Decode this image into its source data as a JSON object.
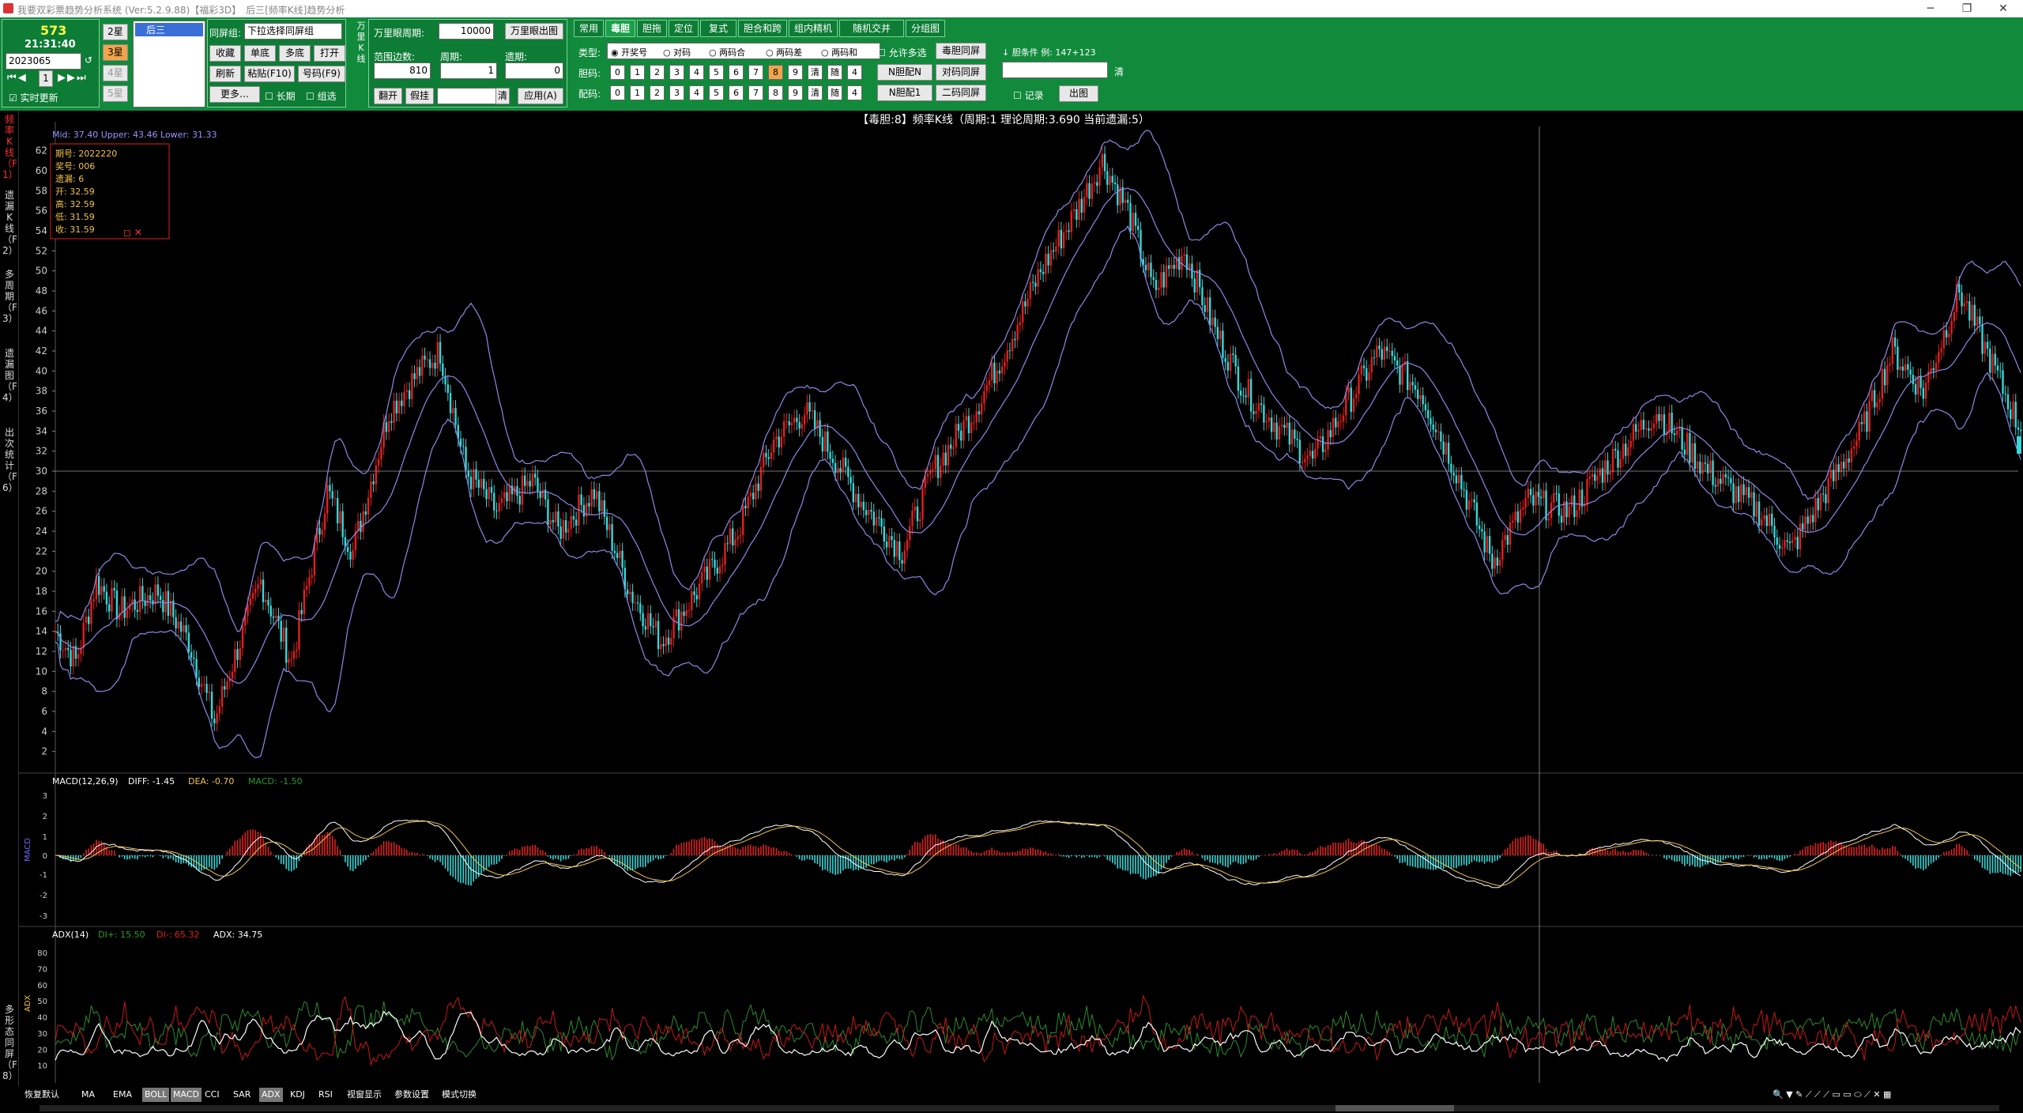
{
  "window": {
    "title": "我要双彩票趋势分析系统 (Ver:5.2.9.88)【福彩3D】　后三[频率K线]趋势分析",
    "min": "─",
    "max": "❐",
    "close": "✕"
  },
  "left": {
    "count": "573",
    "time": "21:31:40",
    "issue": "2023065",
    "play_text": "1",
    "auto_label": "实时更新",
    "stars": [
      "2星",
      "3星",
      "4星",
      "5星"
    ],
    "list_item": "后三"
  },
  "group": {
    "label": "同屏组:",
    "select": "下拉选择同屏组",
    "buttons": [
      "收藏",
      "单底",
      "多底",
      "打开",
      "刷新",
      "粘贴(F10)",
      "号码(F9)",
      "更多…"
    ],
    "chk_longest": "长期",
    "chk_group": "组选"
  },
  "wan": {
    "label": "万里眼周期:",
    "value": "10000",
    "btn": "万里眼出图",
    "fanwei_label": "范围边数:",
    "fanwei": "810",
    "zhouqi_label": "周期:",
    "zhouqi": "1",
    "yilou_label": "遗期:",
    "yilou": "0",
    "btn_fanchu": "翻开",
    "btn_jiagua": "假挂",
    "btn_clear": "清",
    "btn_apply": "应用(A)",
    "side_label": "万里K线"
  },
  "tabs": [
    "常用",
    "毒胆",
    "胆拖",
    "定位",
    "复式",
    "胆合和跨",
    "组内精机",
    "随机交并",
    "分组图"
  ],
  "filter": {
    "type_label": "类型:",
    "types": [
      "开奖号",
      "对码",
      "两码合",
      "两码差",
      "两码和"
    ],
    "multi": "允许多选",
    "btn_same": "毒胆同屏",
    "dan_label": "胆码:",
    "pei_label": "配码:",
    "digits": [
      "0",
      "1",
      "2",
      "3",
      "4",
      "5",
      "6",
      "7",
      "8",
      "9"
    ],
    "clr": "清",
    "rnd": "随",
    "n": "4",
    "btn_n1": "N胆配N",
    "btn_n2": "对码同屏",
    "btn_n3": "N胆配1",
    "btn_n4": "二码同屏"
  },
  "cond": {
    "label": "↓ 胆条件 例: 147+123",
    "clear": "清",
    "chk_label": "记录",
    "btn": "出图"
  },
  "sidebar": [
    "频率K线（F1）",
    "遗漏K线（F2）",
    "多周期（F3）",
    "遗漏图（F4）",
    "出次统计（F6）",
    "多形态同屏（F8）"
  ],
  "chart_info": {
    "title": "【毒胆:8】频率K线（周期:1 理论周期:3.690 当前遗漏:5）",
    "boll_label": "Mid: 37.40  Upper: 43.46  Lower: 31.33",
    "tooltip": [
      "期号: 2022220",
      "奖号: 006",
      "遗漏: 6",
      "开: 32.59",
      "高: 32.59",
      "低: 31.59",
      "收: 31.59"
    ],
    "macd_label": "MACD(12,26,9)",
    "macd_diff": "DIFF: -1.45",
    "macd_dea": "DEA: -0.70",
    "macd_val": "MACD: -1.50",
    "adx_label": "ADX(14)",
    "adx_di_p": "DI+: 15.50",
    "adx_di_m": "DI-: 65.32",
    "adx_val": "ADX: 34.75",
    "macd_side": "MACD",
    "adx_side": "ADX"
  },
  "chart_data": {
    "type": "candlestick",
    "series": [
      {
        "name": "频率K线"
      },
      {
        "name": "Mid"
      },
      {
        "name": "Upper"
      },
      {
        "name": "Lower"
      }
    ],
    "y_ticks": [
      "62",
      "60",
      "58",
      "56",
      "54",
      "52",
      "50",
      "48",
      "46",
      "44",
      "42",
      "40",
      "38",
      "36",
      "34",
      "32",
      "30",
      "28",
      "26",
      "24",
      "22",
      "20",
      "18",
      "16",
      "14",
      "12",
      "10",
      "8",
      "6",
      "4",
      "2"
    ],
    "ylim": [
      0,
      63
    ],
    "macd_ticks": [
      "3",
      "2",
      "1",
      "0",
      "-1",
      "-2",
      "-3"
    ],
    "adx_ticks": [
      "80",
      "70",
      "60",
      "50",
      "40",
      "30",
      "20",
      "10"
    ],
    "crosshair_y": 30,
    "anchors": [
      [
        0,
        14
      ],
      [
        8,
        11
      ],
      [
        16,
        19
      ],
      [
        25,
        16
      ],
      [
        40,
        18
      ],
      [
        52,
        13
      ],
      [
        62,
        5
      ],
      [
        68,
        10
      ],
      [
        80,
        19
      ],
      [
        92,
        11
      ],
      [
        106,
        28
      ],
      [
        116,
        22
      ],
      [
        130,
        36
      ],
      [
        142,
        40
      ],
      [
        150,
        42
      ],
      [
        160,
        30
      ],
      [
        172,
        26
      ],
      [
        186,
        29
      ],
      [
        196,
        24
      ],
      [
        210,
        28
      ],
      [
        224,
        18
      ],
      [
        236,
        13
      ],
      [
        250,
        18
      ],
      [
        266,
        24
      ],
      [
        280,
        33
      ],
      [
        292,
        36
      ],
      [
        302,
        32
      ],
      [
        314,
        27
      ],
      [
        330,
        22
      ],
      [
        342,
        30
      ],
      [
        358,
        36
      ],
      [
        370,
        42
      ],
      [
        384,
        50
      ],
      [
        398,
        56
      ],
      [
        408,
        61
      ],
      [
        418,
        56
      ],
      [
        428,
        48
      ],
      [
        440,
        52
      ],
      [
        452,
        44
      ],
      [
        464,
        38
      ],
      [
        478,
        34
      ],
      [
        490,
        31
      ],
      [
        504,
        37
      ],
      [
        516,
        42
      ],
      [
        532,
        38
      ],
      [
        546,
        30
      ],
      [
        560,
        21
      ],
      [
        574,
        27
      ],
      [
        590,
        26
      ],
      [
        606,
        31
      ],
      [
        624,
        36
      ],
      [
        644,
        30
      ],
      [
        664,
        26
      ],
      [
        676,
        22
      ],
      [
        690,
        28
      ],
      [
        704,
        34
      ],
      [
        716,
        42
      ],
      [
        728,
        38
      ],
      [
        742,
        48
      ],
      [
        756,
        40
      ],
      [
        766,
        34
      ]
    ],
    "n": 766
  },
  "bottom": {
    "items": [
      "恢复默认",
      "MA",
      "EMA",
      "BOLL",
      "MACD",
      "CCI",
      "SAR",
      "ADX",
      "KDJ",
      "RSI",
      "视窗显示",
      "参数设置",
      "模式切换"
    ],
    "active": [
      "BOLL",
      "MACD",
      "ADX"
    ]
  }
}
